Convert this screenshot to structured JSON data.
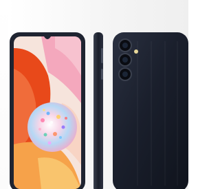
{
  "product": {
    "views": [
      "front",
      "side",
      "back"
    ],
    "body_color": "#1d2230",
    "frame_color": "#2a2f3c",
    "screen_colors": [
      "#e84f1e",
      "#f06a3a",
      "#f5a3b6",
      "#f7c9c0",
      "#f8b46a"
    ],
    "camera_count": 3
  }
}
